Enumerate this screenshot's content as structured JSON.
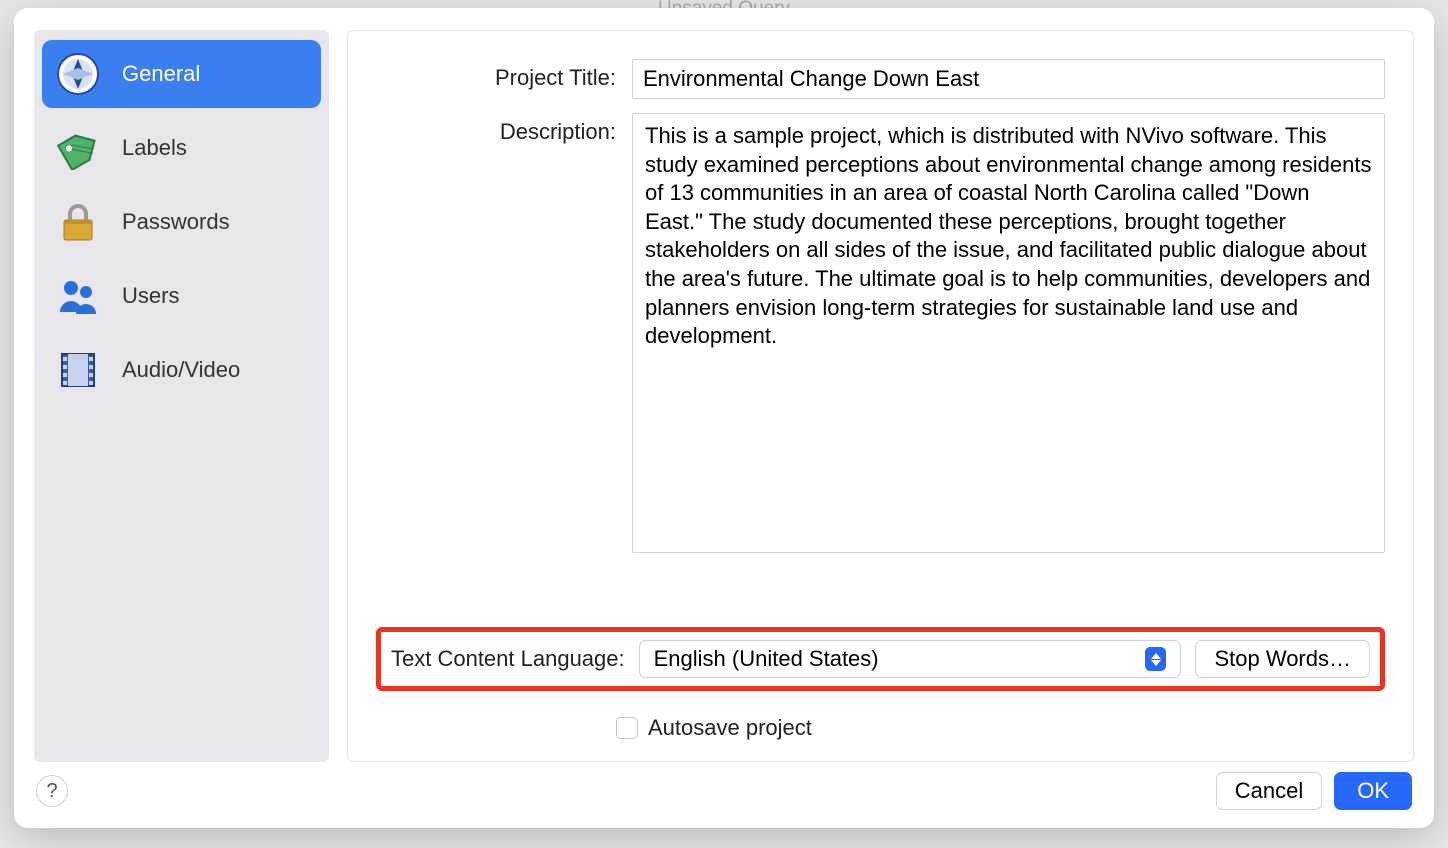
{
  "background_hint": "Unsaved Query",
  "sidebar": {
    "items": [
      {
        "label": "General",
        "icon": "compass-icon",
        "selected": true
      },
      {
        "label": "Labels",
        "icon": "tag-icon",
        "selected": false
      },
      {
        "label": "Passwords",
        "icon": "lock-icon",
        "selected": false
      },
      {
        "label": "Users",
        "icon": "users-icon",
        "selected": false
      },
      {
        "label": "Audio/Video",
        "icon": "film-icon",
        "selected": false
      }
    ]
  },
  "form": {
    "title_label": "Project Title:",
    "title_value": "Environmental Change Down East",
    "description_label": "Description:",
    "description_value": "This is a sample project, which is distributed with NVivo software. This study examined perceptions about environmental change among residents of 13 communities in an area of coastal North Carolina called \"Down East.\" The study documented these perceptions, brought together stakeholders on all sides of the issue, and facilitated public dialogue about the area's future. The ultimate goal is to help communities, developers and planners envision long-term strategies for sustainable land use and development.",
    "language_label": "Text Content Language:",
    "language_value": "English (United States)",
    "stop_words_label": "Stop Words…",
    "autosave_label": "Autosave project",
    "autosave_checked": false
  },
  "footer": {
    "help": "?",
    "cancel": "Cancel",
    "ok": "OK"
  },
  "highlight_color": "#eb3323"
}
